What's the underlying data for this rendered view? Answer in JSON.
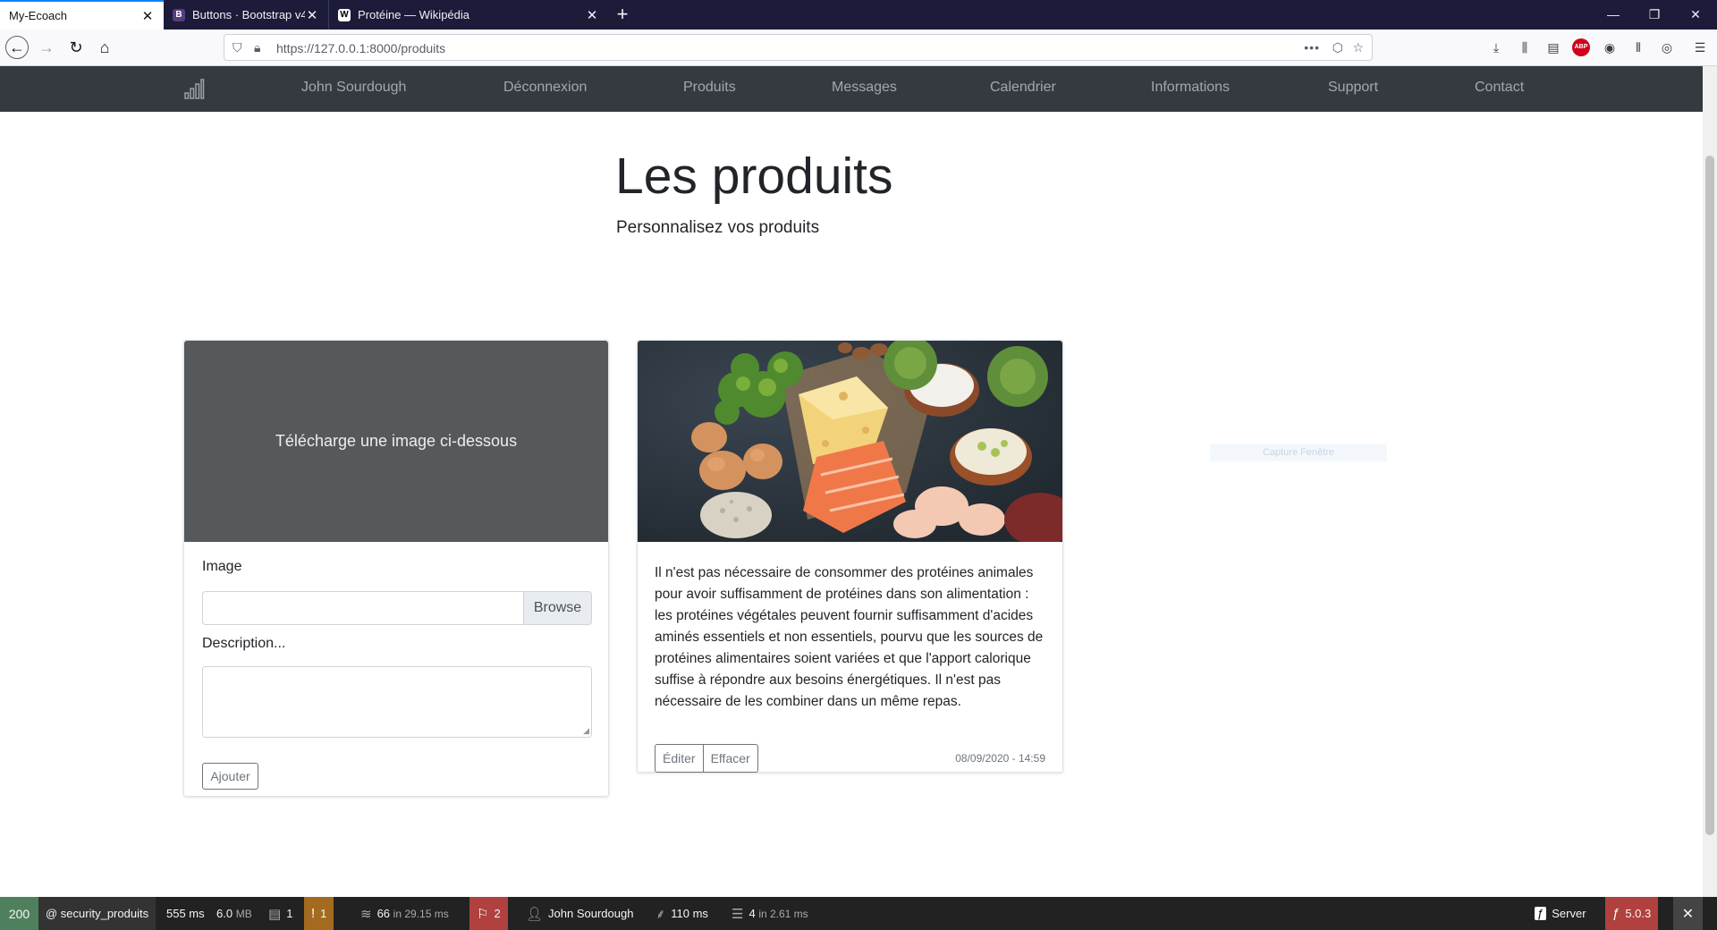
{
  "browser": {
    "tabs": [
      {
        "title": "My-Ecoach",
        "active": true,
        "icon": "page-icon"
      },
      {
        "title": "Buttons · Bootstrap v4.5",
        "active": false,
        "icon": "bootstrap-icon",
        "icon_text": "B"
      },
      {
        "title": "Protéine — Wikipédia",
        "active": false,
        "icon": "wikipedia-icon",
        "icon_text": "W"
      }
    ],
    "url_host": "https://127.0.0.1",
    "url_path": ":8000/produits"
  },
  "site": {
    "nav_links": [
      "John Sourdough",
      "Déconnexion",
      "Produits",
      "Messages",
      "Calendrier",
      "Informations",
      "Support",
      "Contact"
    ],
    "title": "Les produits",
    "subtitle": "Personnalisez vos produits"
  },
  "form_card": {
    "placeholder_text": "Télécharge une image ci-dessous",
    "image_label": "Image",
    "browse_label": "Browse",
    "description_label": "Description...",
    "submit_label": "Ajouter"
  },
  "product_card": {
    "text": "Il n'est pas nécessaire de consommer des protéines animales pour avoir suffisamment de protéines dans son alimentation : les protéines végétales peuvent fournir suffisamment d'acides aminés essentiels et non essentiels, pourvu que les sources de protéines alimentaires soient variées et que l'apport calorique suffise à répondre aux besoins énergétiques. Il n'est pas nécessaire de les combiner dans un même repas.",
    "edit_label": "Éditer",
    "delete_label": "Effacer",
    "date": "08/09/2020 - 14:59"
  },
  "overlay": {
    "ghost_text": "Capture Fenêtre"
  },
  "debug_toolbar": {
    "status": "200",
    "route": "@ security_produits",
    "time": "555 ms",
    "memory": "6.0",
    "memory_unit": "MB",
    "forms": "1",
    "logs": "1",
    "cache_count": "66",
    "cache_time": "in 29.15 ms",
    "translations": "2",
    "user": "John Sourdough",
    "twig": "110 ms",
    "db_count": "4",
    "db_time": "in 2.61 ms",
    "server": "Server",
    "version": "5.0.3"
  },
  "colors": {
    "tabbar": "#1c1b3a",
    "site_nav": "#343a40",
    "placeholder": "#55595c",
    "debug_status": "#4f805d",
    "debug_warning": "#a46a1f",
    "debug_error": "#b0413e"
  }
}
